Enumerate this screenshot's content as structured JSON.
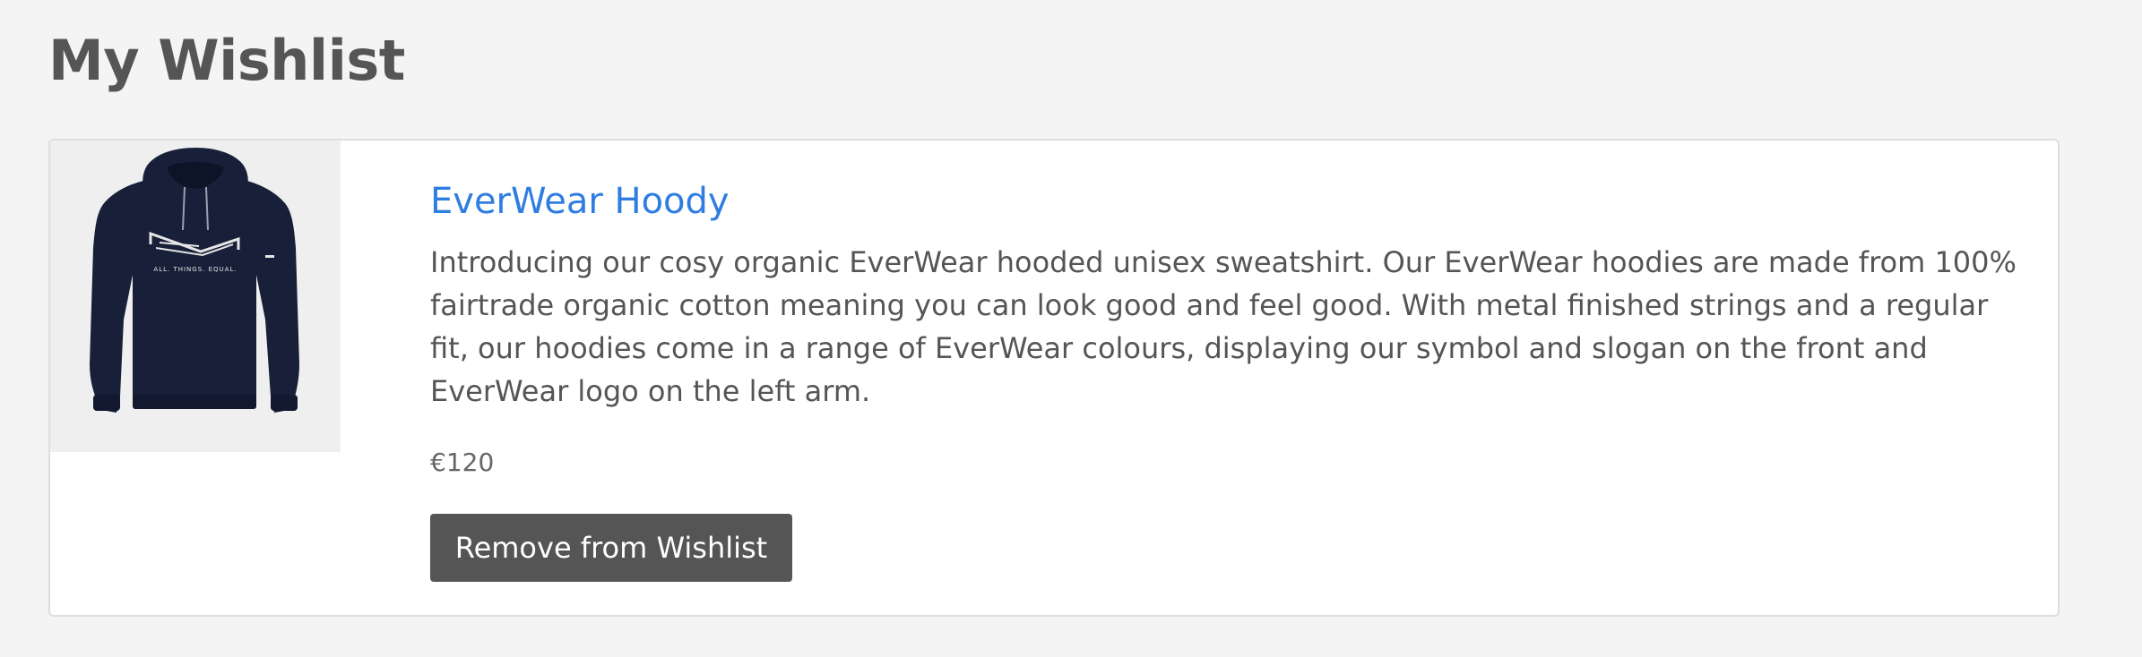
{
  "page": {
    "title": "My Wishlist"
  },
  "wishlist": {
    "items": [
      {
        "name": "EverWear Hoody",
        "description": "Introducing our cosy organic EverWear hooded unisex sweatshirt. Our EverWear hoodies are made from 100% fairtrade organic cotton meaning you can look good and feel good. With metal finished strings and a regular fit, our hoodies come in a range of EverWear colours, displaying our symbol and slogan on the front and EverWear logo on the left arm.",
        "price": "€120",
        "image_slogan": "ALL. THINGS. EQUAL.",
        "remove_label": "Remove from Wishlist"
      }
    ]
  },
  "colors": {
    "background": "#f4f4f4",
    "card": "#ffffff",
    "card_border": "#dedede",
    "link": "#2f7de1",
    "text": "#555555",
    "button": "#555555",
    "button_text": "#ffffff",
    "hoodie": "#182039"
  }
}
